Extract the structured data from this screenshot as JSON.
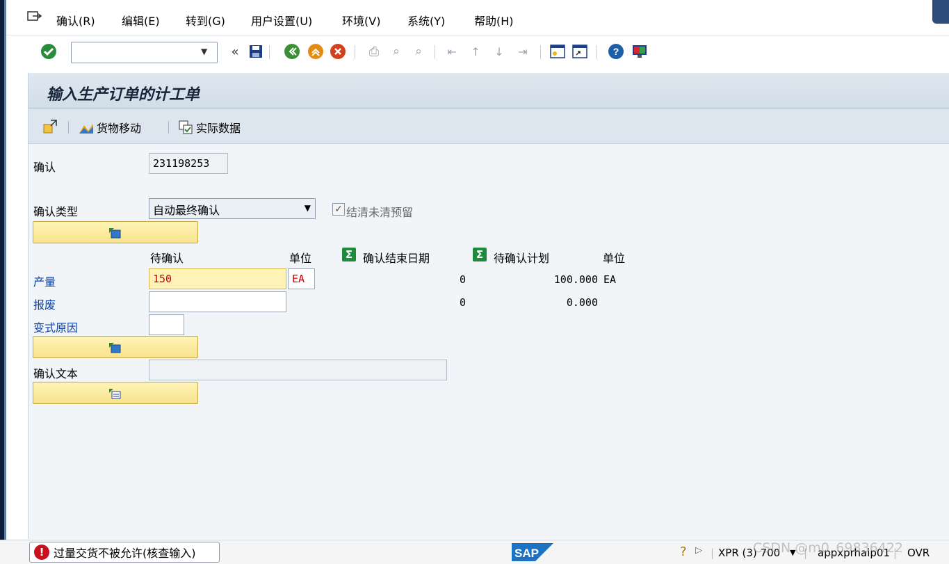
{
  "menu": {
    "items": [
      {
        "label": "确认(R)"
      },
      {
        "label": "编辑(E)"
      },
      {
        "label": "转到(G)"
      },
      {
        "label": "用户设置(U)"
      },
      {
        "label": "环境(V)"
      },
      {
        "label": "系统(Y)"
      },
      {
        "label": "帮助(H)"
      }
    ]
  },
  "toolbar": {
    "command_field_value": "",
    "icons": [
      "enter-icon",
      "save-icon",
      "back-icon",
      "exit-icon",
      "cancel-icon",
      "print-icon",
      "find-icon",
      "find-next-icon",
      "first-page-icon",
      "previous-page-icon",
      "next-page-icon",
      "last-page-icon",
      "new-session-icon",
      "shortcut-icon",
      "help-icon",
      "layout-icon"
    ]
  },
  "page": {
    "title": "输入生产订单的计工单"
  },
  "app_toolbar": {
    "goods_movement": "货物移动",
    "actual_data": "实际数据"
  },
  "form": {
    "confirmation_label": "确认",
    "confirmation_value": "231198253",
    "confirmation_type_label": "确认类型",
    "confirmation_type_value": "自动最终确认",
    "clear_reservations_label": "结清未清预留",
    "clear_reservations_checked": true,
    "col_to_confirm": "待确认",
    "col_unit": "单位",
    "col_confirmed_end": "确认结束日期",
    "col_planned_to_confirm": "待确认计划",
    "col_unit2": "单位",
    "yield_label": "产量",
    "yield_value": "150",
    "yield_unit": "EA",
    "yield_confirmed": "0",
    "yield_planned": "100.000",
    "yield_planned_unit": "EA",
    "scrap_label": "报废",
    "scrap_value": "",
    "scrap_confirmed": "0",
    "scrap_planned": "0.000",
    "variance_label": "变式原因",
    "variance_value": "",
    "text_label": "确认文本",
    "text_value": ""
  },
  "status": {
    "message": "过量交货不被允许(核查输入)",
    "system": "XPR (3) 700",
    "server": "appxprhaip01",
    "mode": "OVR",
    "watermark": "CSDN @m0_69836422",
    "brand": "SAP"
  },
  "colors": {
    "accent": "#0a3fa8",
    "error": "#c8101e",
    "highlight": "#fff3b7"
  }
}
